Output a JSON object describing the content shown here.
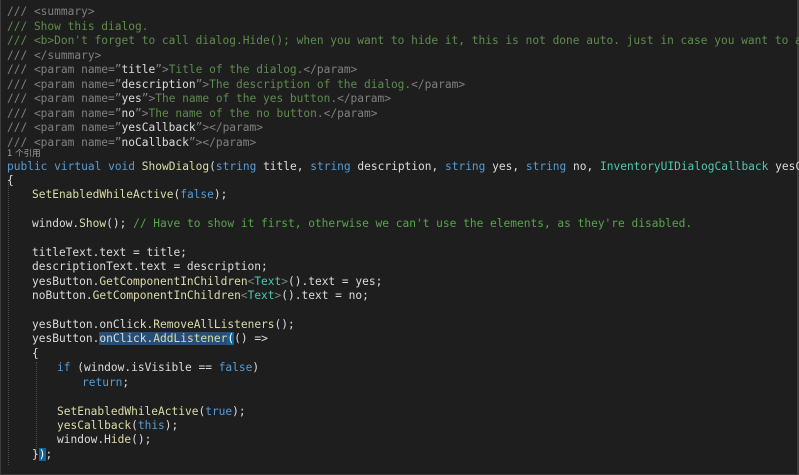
{
  "code_lens": "1 个引用",
  "summary_open": "/// <summary>",
  "summary_line1": "/// Show this dialog.",
  "summary_line2": "/// <b>Don't forget to call dialog.Hide(); when you want to hide it, this is not done auto. just in case you want to animate it",
  "summary_close": "/// </summary>",
  "params": [
    {
      "name": "title",
      "desc": "Title of the dialog.",
      "close": "</param>"
    },
    {
      "name": "description",
      "desc": "The description of the dialog.",
      "close": "</param>"
    },
    {
      "name": "yes",
      "desc": "The name of the yes button.",
      "close": "</param>"
    },
    {
      "name": "no",
      "desc": "The name of the no button.",
      "close": "</param>"
    },
    {
      "name": "yesCallback",
      "desc": "",
      "close": "</param>"
    },
    {
      "name": "noCallback",
      "desc": "",
      "close": "</param>"
    }
  ],
  "sig": {
    "public": "public",
    "virtual": "virtual",
    "void": "void",
    "method": "ShowDialog",
    "string": "string",
    "p_title": "title",
    "p_description": "description",
    "p_yes": "yes",
    "p_no": "no",
    "cb_type": "InventoryUIDialogCallback",
    "p_yesCallback": "yesCallback,"
  },
  "body": {
    "open_brace": "{",
    "l1_method": "SetEnabledWhileActive",
    "false": "false",
    "l2_obj": "window",
    "l2_method": "Show",
    "l2_comment": "// Have to show it first, otherwise we can't use the elements, as they're disabled.",
    "l3": "titleText.text = title;",
    "l4": "descriptionText.text = description;",
    "yesButton": "yesButton",
    "noButton": "noButton",
    "getcomp": "GetComponentInChildren",
    "text_type": "Text",
    "l5_tail": "().text = yes;",
    "l6_tail": "().text = no;",
    "onclick_remove": "onClick",
    "remove": "RemoveAllListeners",
    "onclick_add": "onClick",
    "add": "AddListener",
    "lambda": "() =>",
    "inner_open": "{",
    "if": "if",
    "cond": "(window.isVisible == ",
    "return": "return",
    "l_setenabled": "SetEnabledWhileActive",
    "true": "true",
    "yescb": "yesCallback",
    "this": "this",
    "hide_obj": "window",
    "hide_method": "Hide",
    "close_inner": "});"
  }
}
